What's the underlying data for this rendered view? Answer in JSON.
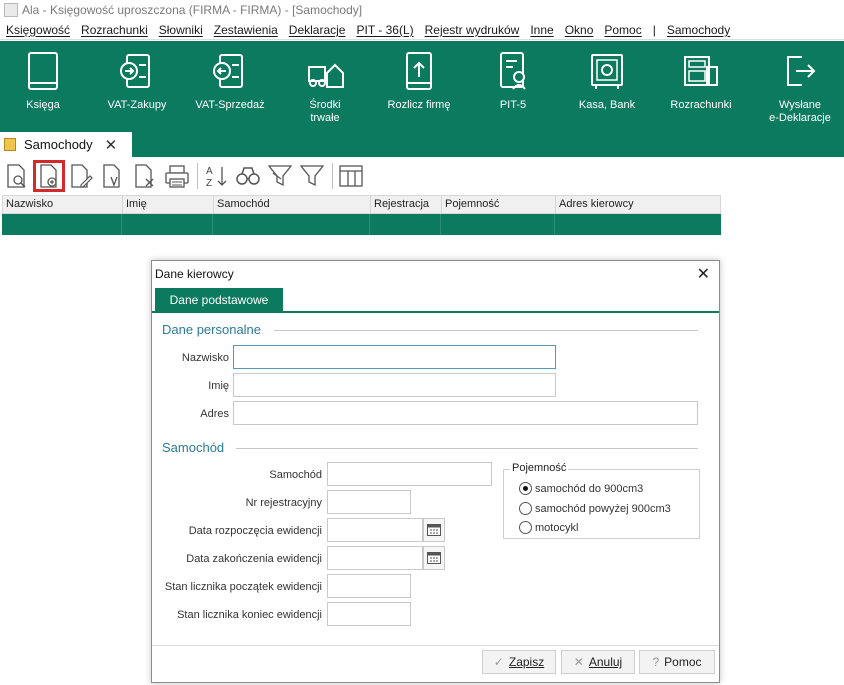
{
  "window": {
    "title": "Ala - Księgowość uproszczona (FIRMA - FIRMA) - [Samochody]"
  },
  "menu": [
    "Księgowość",
    "Rozrachunki",
    "Słowniki",
    "Zestawienia",
    "Deklaracje",
    "PIT - 36(L)",
    "Rejestr wydruków",
    "Inne",
    "Okno",
    "Pomoc",
    "|",
    "Samochody"
  ],
  "ribbon": [
    {
      "label": "Księga",
      "icon": "book-icon"
    },
    {
      "label": "VAT-Zakupy",
      "icon": "vat-purchase-icon"
    },
    {
      "label": "VAT-Sprzedaż",
      "icon": "vat-sales-icon"
    },
    {
      "label": "Środki\ntrwałe",
      "icon": "fixed-assets-icon"
    },
    {
      "label": "Rozlicz firmę",
      "icon": "settle-company-icon"
    },
    {
      "label": "PIT-5",
      "icon": "pit5-icon"
    },
    {
      "label": "Kasa, Bank",
      "icon": "safe-icon"
    },
    {
      "label": "Rozrachunki",
      "icon": "settlements-icon"
    },
    {
      "label": "Wysłane\ne-Deklaracje",
      "icon": "sent-declarations-icon"
    }
  ],
  "doc_tab": {
    "label": "Samochody",
    "close": "✕"
  },
  "toolbar": [
    "preview-icon",
    "add-document-icon",
    "edit-document-icon",
    "verify-document-icon",
    "delete-document-icon",
    "print-icon",
    "sort-az-icon",
    "find-icon",
    "filter-icon",
    "filter-clear-icon",
    "columns-icon"
  ],
  "grid": {
    "columns": [
      "Nazwisko",
      "Imię",
      "Samochód",
      "Rejestracja",
      "Pojemność",
      "Adres kierowcy"
    ]
  },
  "dialog": {
    "title": "Dane kierowcy",
    "close": "✕",
    "tab": "Dane podstawowe",
    "section_personal": "Dane personalne",
    "label_surname": "Nazwisko",
    "label_firstname": "Imię",
    "label_address": "Adres",
    "section_car": "Samochód",
    "label_car": "Samochód",
    "label_reg": "Nr rejestracyjny",
    "label_start_date": "Data rozpoczęcia ewidencji",
    "label_end_date": "Data zakończenia ewidencji",
    "label_odo_start": "Stan licznika początek ewidencji",
    "label_odo_end": "Stan licznika koniec ewidencji",
    "capacity_title": "Pojemność",
    "capacity_options": [
      "samochód do 900cm3",
      "samochód powyżej 900cm3",
      "motocykl"
    ],
    "capacity_selected": 0,
    "btn_save": "Zapisz",
    "btn_cancel": "Anuluj",
    "btn_help": "Pomoc"
  },
  "colors": {
    "accent": "#0c7a5e",
    "highlight": "#d22a2a",
    "section": "#2b7a98"
  }
}
